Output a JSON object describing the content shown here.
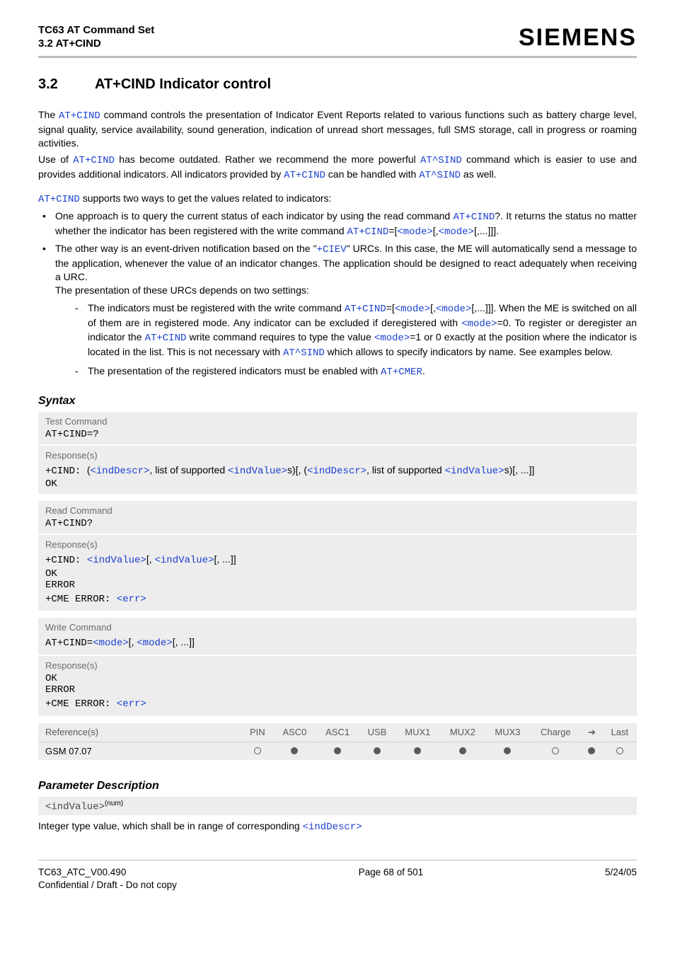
{
  "header": {
    "title": "TC63 AT Command Set",
    "subtitle": "3.2 AT+CIND",
    "brand": "SIEMENS"
  },
  "section": {
    "number": "3.2",
    "title": "AT+CIND   Indicator control"
  },
  "intro": {
    "p1_a": "The ",
    "p1_cmd1": "AT+CIND",
    "p1_b": " command controls the presentation of Indicator Event Reports related to various functions such as battery charge level, signal quality, service availability, sound generation, indication of unread short messages, full SMS storage, call in progress or roaming activities.",
    "p2_a": "Use of ",
    "p2_cmd1": "AT+CIND",
    "p2_b": " has become outdated. Rather we recommend the more powerful ",
    "p2_cmd2": "AT^SIND",
    "p2_c": " command which is easier to use and provides additional indicators. All indicators provided by ",
    "p2_cmd3": "AT+CIND",
    "p2_d": " can be handled with ",
    "p2_cmd4": "AT^SIND",
    "p2_e": " as well.",
    "p3_cmd": "AT+CIND",
    "p3_rest": " supports two ways to get the values related to indicators:"
  },
  "bullets": {
    "b1_a": "One approach is to query the current status of each indicator by using the read command ",
    "b1_cmd1": "AT+CIND",
    "b1_b": "?. It returns the status no matter whether the indicator has been registered with the write command ",
    "b1_cmd2": "AT+CIND",
    "b1_c": "=[",
    "b1_mode1": "<mode>",
    "b1_d": "[,",
    "b1_mode2": "<mode>",
    "b1_e": "[,...]]].",
    "b2_a": "The other way is an event-driven notification based on the \"",
    "b2_urc": "+CIEV",
    "b2_b": "\" URCs. In this case, the ME will automatically send a message to the application, whenever the value of an indicator changes. The application should be designed to react adequately when receiving a URC.",
    "b2_c": "The presentation of these URCs depends on two settings:"
  },
  "dashes": {
    "d1_a": "The indicators must be registered with the write command ",
    "d1_cmd1": "AT+CIND",
    "d1_b": "=[",
    "d1_mode1": "<mode>",
    "d1_c": "[,",
    "d1_mode2": "<mode>",
    "d1_d": "[,...]]]. When the ME is switched on all of them are in registered mode. Any indicator can be excluded if deregistered with ",
    "d1_mode3": "<mode>",
    "d1_e": "=0. To register or deregister an indicator the ",
    "d1_cmd2": "AT+CIND",
    "d1_f": " write command requires to type the value ",
    "d1_mode4": "<mode>",
    "d1_g": "=1 or 0 exactly at the position where the indicator is located in the list. This is not necessary with ",
    "d1_cmd3": "AT^SIND",
    "d1_h": " which allows to specify indicators by name. See examples below.",
    "d2_a": "The presentation of the registered indicators must be enabled with ",
    "d2_cmd": "AT+CMER",
    "d2_b": "."
  },
  "syntax": {
    "heading": "Syntax",
    "test_label": "Test Command",
    "test_cmd": "AT+CIND=?",
    "test_resp_label": "Response(s)",
    "test_resp_prefix": "+CIND: ",
    "test_resp_open": "(",
    "inddescr": "<indDescr>",
    "test_resp_mid1": ", list of supported ",
    "indvalue": "<indValue>",
    "test_resp_mid2": "s)[, (",
    "test_resp_mid3": ", list of supported ",
    "test_resp_mid4": "s)[, ...]]",
    "ok": "OK",
    "read_label": "Read Command",
    "read_cmd": "AT+CIND?",
    "read_resp_label": "Response(s)",
    "read_resp_prefix": "+CIND: ",
    "read_resp_bracket1": "[, ",
    "read_resp_bracket2": "[, ...]]",
    "error": "ERROR",
    "cme": "+CME ERROR: ",
    "err": "<err>",
    "write_label": "Write Command",
    "write_cmd_prefix": "AT+CIND=",
    "mode": "<mode>",
    "write_cmd_b1": "[, ",
    "write_cmd_b2": "[, ...]]",
    "write_resp_label": "Response(s)",
    "ref_label": "Reference(s)",
    "ref_value": "GSM 07.07",
    "cols": [
      "PIN",
      "ASC0",
      "ASC1",
      "USB",
      "MUX1",
      "MUX2",
      "MUX3",
      "Charge",
      "➔",
      "Last"
    ],
    "dots": [
      "open",
      "filled",
      "filled",
      "filled",
      "filled",
      "filled",
      "filled",
      "open",
      "filled",
      "open"
    ]
  },
  "paramdesc": {
    "heading": "Parameter Description",
    "param_name": "<indValue>",
    "param_type": "(num)",
    "line_a": "Integer type value, which shall be in range of corresponding ",
    "line_link": "<indDescr>"
  },
  "footer": {
    "left1": "TC63_ATC_V00.490",
    "left2": "Confidential / Draft - Do not copy",
    "center": "Page 68 of 501",
    "right": "5/24/05"
  }
}
